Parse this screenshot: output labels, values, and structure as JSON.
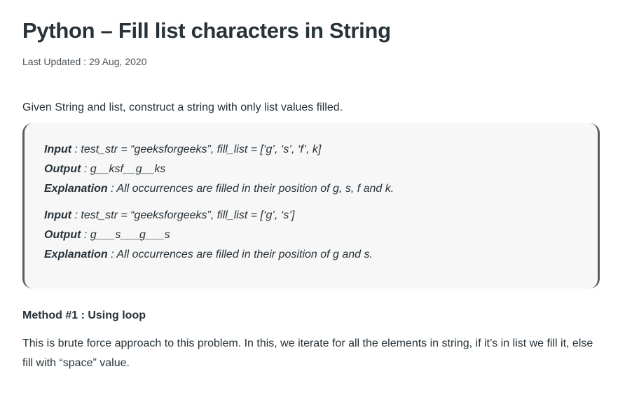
{
  "article": {
    "title": "Python – Fill list characters in String",
    "last_updated": "Last Updated : 29 Aug, 2020",
    "intro": "Given String and list, construct a string with only list values filled."
  },
  "examples": [
    {
      "input_label": "Input",
      "input_text": " : test_str = “geeksforgeeks”, fill_list = [‘g’, ‘s’, ‘f’, k]",
      "output_label": "Output",
      "output_text": " : g__ksf__g__ks",
      "explanation_label": "Explanation",
      "explanation_text": " : All occurrences are filled in their position of g, s, f and k."
    },
    {
      "input_label": "Input",
      "input_text": " : test_str = “geeksforgeeks”, fill_list = [‘g’, ‘s’]",
      "output_label": "Output",
      "output_text": " : g___s___g___s",
      "explanation_label": "Explanation",
      "explanation_text": " : All occurrences are filled in their position of g and s."
    }
  ],
  "method": {
    "heading": "Method #1 : Using loop",
    "description": "This is brute force approach to this problem. In this, we iterate for all the elements in string, if it’s in list we fill it, else fill with “space” value."
  }
}
